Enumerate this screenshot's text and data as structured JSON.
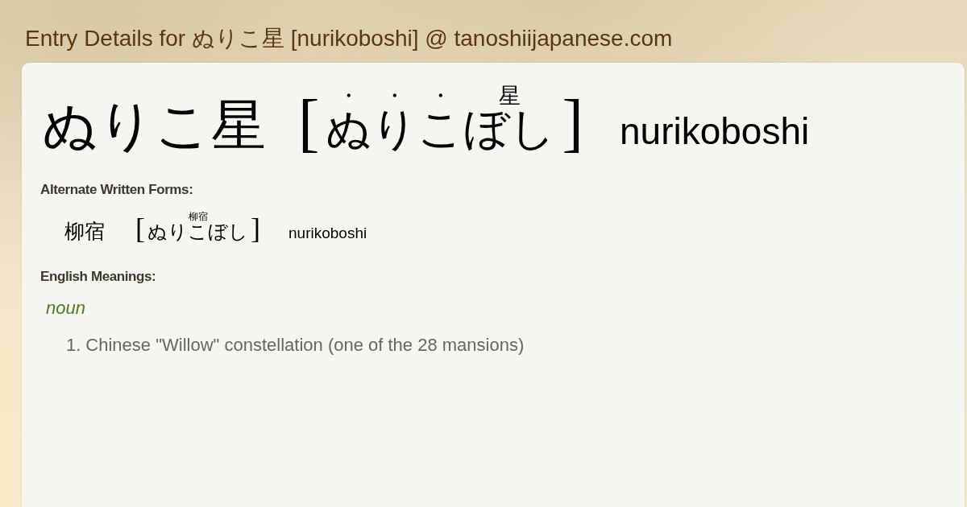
{
  "page_title": "Entry Details for ぬりこ星 [nurikoboshi] @ tanoshiijapanese.com",
  "entry": {
    "headword": "ぬりこ星",
    "bracket_open": "[",
    "reading": [
      {
        "text": "ぬ",
        "ruby": "・"
      },
      {
        "text": "り",
        "ruby": "・"
      },
      {
        "text": "こ",
        "ruby": "・"
      },
      {
        "text": "ぼし",
        "ruby": "星"
      }
    ],
    "bracket_close": "]",
    "romaji": "nurikoboshi"
  },
  "alternate_forms": {
    "heading": "Alternate Written Forms:",
    "items": [
      {
        "written": "柳宿",
        "bracket_open": "[",
        "reading": [
          {
            "text": "ぬりこぼし",
            "ruby": "柳宿"
          }
        ],
        "bracket_close": "]",
        "romaji": "nurikoboshi"
      }
    ]
  },
  "meanings": {
    "heading": "English Meanings:",
    "groups": [
      {
        "part_of_speech": "noun",
        "senses": [
          {
            "number": "1.",
            "text": "Chinese \"Willow\" constellation (one of the 28 mansions)"
          }
        ]
      }
    ]
  }
}
